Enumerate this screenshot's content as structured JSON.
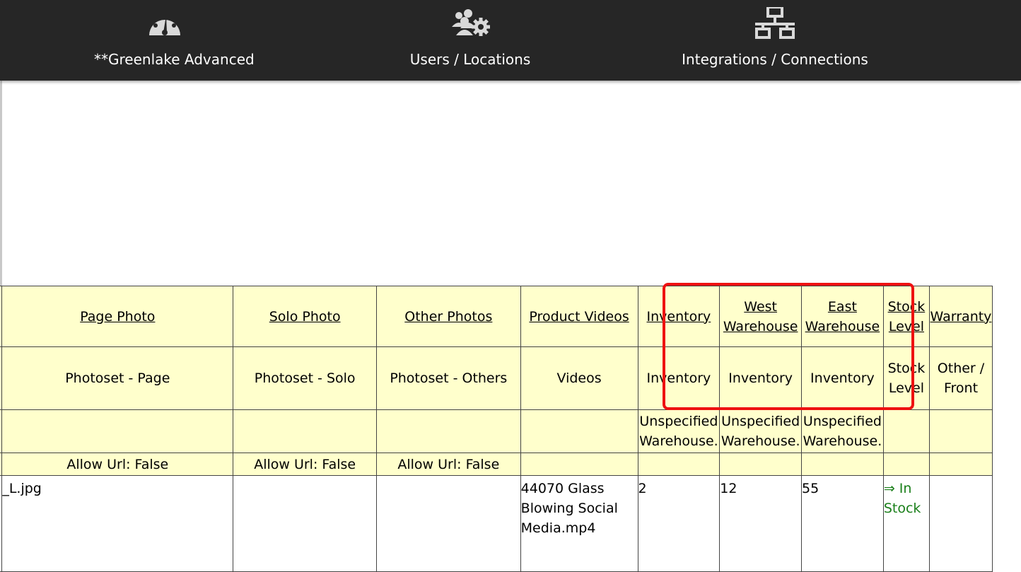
{
  "nav": {
    "items": [
      {
        "label": "**Greenlake Advanced",
        "icon": "dashboard-gauge-icon"
      },
      {
        "label": "Users / Locations",
        "icon": "users-gear-icon"
      },
      {
        "label": "Integrations / Connections",
        "icon": "network-icon"
      }
    ]
  },
  "table": {
    "headers": [
      "",
      "Page Photo",
      "Solo Photo",
      "Other Photos",
      "Product Videos",
      "Inventory",
      "West Warehouse",
      "East Warehouse",
      "Stock Level",
      "Warranty"
    ],
    "subheaders": [
      "",
      "Photoset - Page",
      "Photoset - Solo",
      "Photoset - Others",
      "Videos",
      "Inventory",
      "Inventory",
      "Inventory",
      "Stock Level",
      "Other / Front"
    ],
    "warehouse_row": [
      "",
      "",
      "",
      "",
      "",
      "Unspecified Warehouse.",
      "Unspecified Warehouse.",
      "Unspecified Warehouse.",
      "",
      ""
    ],
    "allow_row": [
      "",
      "Allow Url: False",
      "Allow Url: False",
      "Allow Url: False",
      "",
      "",
      "",
      "",
      "",
      ""
    ],
    "data_row": [
      "",
      "_L.jpg",
      "",
      "",
      "44070 Glass Blowing Social Media.mp4",
      "2",
      "12",
      "55",
      "⇒ In Stock",
      ""
    ]
  },
  "colors": {
    "nav_bg": "#262626",
    "header_bg": "#ffffcc",
    "highlight": "#ee1111",
    "in_stock": "#1a7f1a"
  }
}
